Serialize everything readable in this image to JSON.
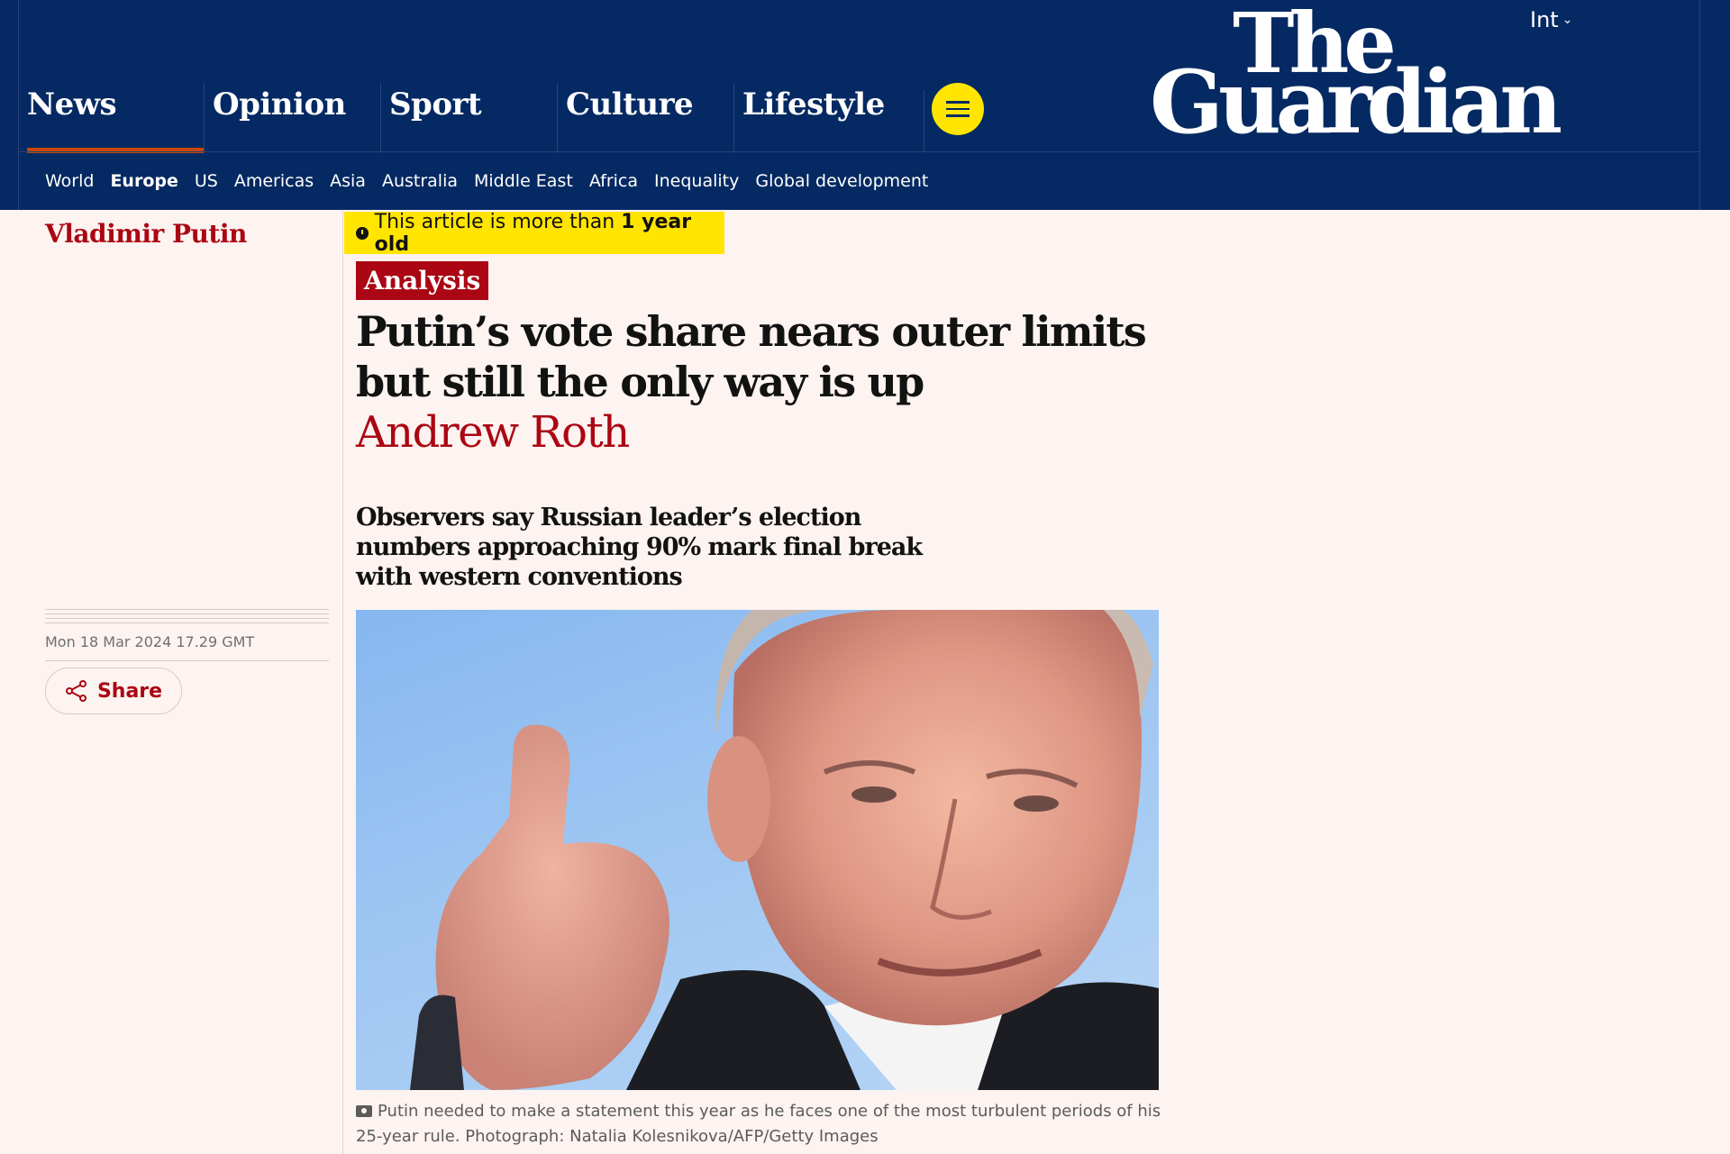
{
  "header": {
    "edition": "Int",
    "logo_line1": "The",
    "logo_line2": "Guardian",
    "pillars": [
      {
        "label": "News",
        "active": true
      },
      {
        "label": "Opinion"
      },
      {
        "label": "Sport"
      },
      {
        "label": "Culture"
      },
      {
        "label": "Lifestyle"
      }
    ],
    "subnav": [
      "World",
      "Europe",
      "US",
      "Americas",
      "Asia",
      "Australia",
      "Middle East",
      "Africa",
      "Inequality",
      "Global development"
    ],
    "subnav_selected": "Europe"
  },
  "article": {
    "series": "Vladimir Putin",
    "age_notice_prefix": "This article is more than ",
    "age_notice_bold": "1 year old",
    "kicker": "Analysis",
    "headline": "Putin’s vote share nears outer limits but still the only way is up",
    "byline": "Andrew Roth",
    "standfirst": "Observers say Russian leader’s election numbers approaching 90% mark final break with western conventions",
    "dateline": "Mon 18 Mar 2024 17.29 GMT",
    "share_label": "Share",
    "caption": "Putin needed to make a statement this year as he faces one of the most turbulent periods of his 25-year rule. Photograph: Natalia Kolesnikova/AFP/Getty Images"
  },
  "colors": {
    "brand_blue": "#052962",
    "accent_red": "#ab0613",
    "highlight_yellow": "#ffe500",
    "page_bg": "#fdf3f0"
  }
}
